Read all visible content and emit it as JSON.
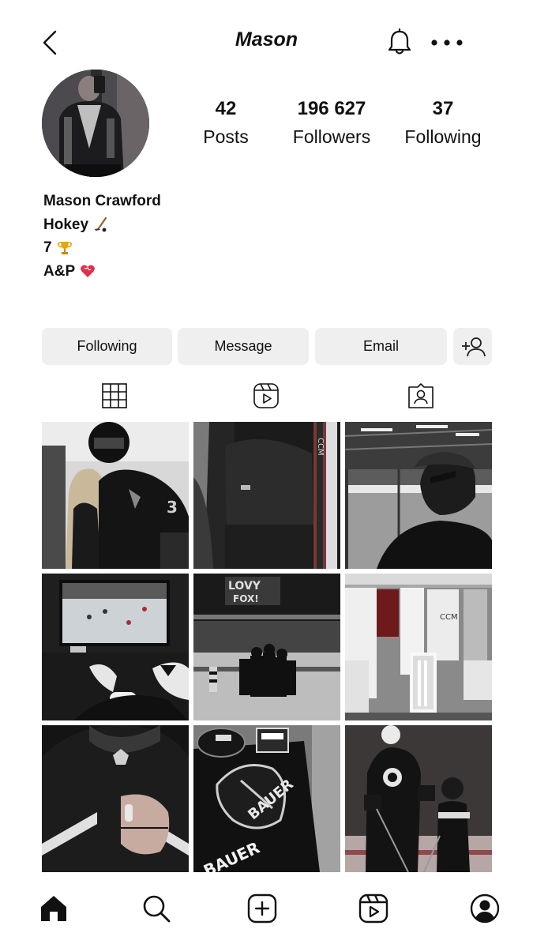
{
  "header": {
    "title": "Mason",
    "back_icon": "chevron-left-icon",
    "bell_icon": "bell-icon",
    "more_icon": "more-dots-icon"
  },
  "profile": {
    "stats": [
      {
        "value": "42",
        "label": "Posts"
      },
      {
        "value": "196 627",
        "label": "Followers"
      },
      {
        "value": "37",
        "label": "Following"
      }
    ],
    "bio": {
      "name": "Mason Crawford",
      "line1": "Hokey",
      "line2": "7",
      "line3": "A&P"
    }
  },
  "actions": {
    "following": "Following",
    "message": "Message",
    "email": "Email",
    "add_icon": "add-person-icon"
  },
  "tabs": [
    "grid-icon",
    "reels-icon",
    "tagged-icon"
  ],
  "posts": [
    "post-couple-kiss",
    "post-sticks-locker",
    "post-rink-cap",
    "post-tv-gaming",
    "post-arena-celebration",
    "post-locker-room",
    "post-nhl-hoodie",
    "post-gear-bag",
    "post-practice-kid"
  ],
  "bottom_nav": [
    "home-icon",
    "search-icon",
    "create-icon",
    "reels-icon",
    "profile-icon"
  ],
  "colors": {
    "button_bg": "#efefef",
    "text": "#111111"
  }
}
